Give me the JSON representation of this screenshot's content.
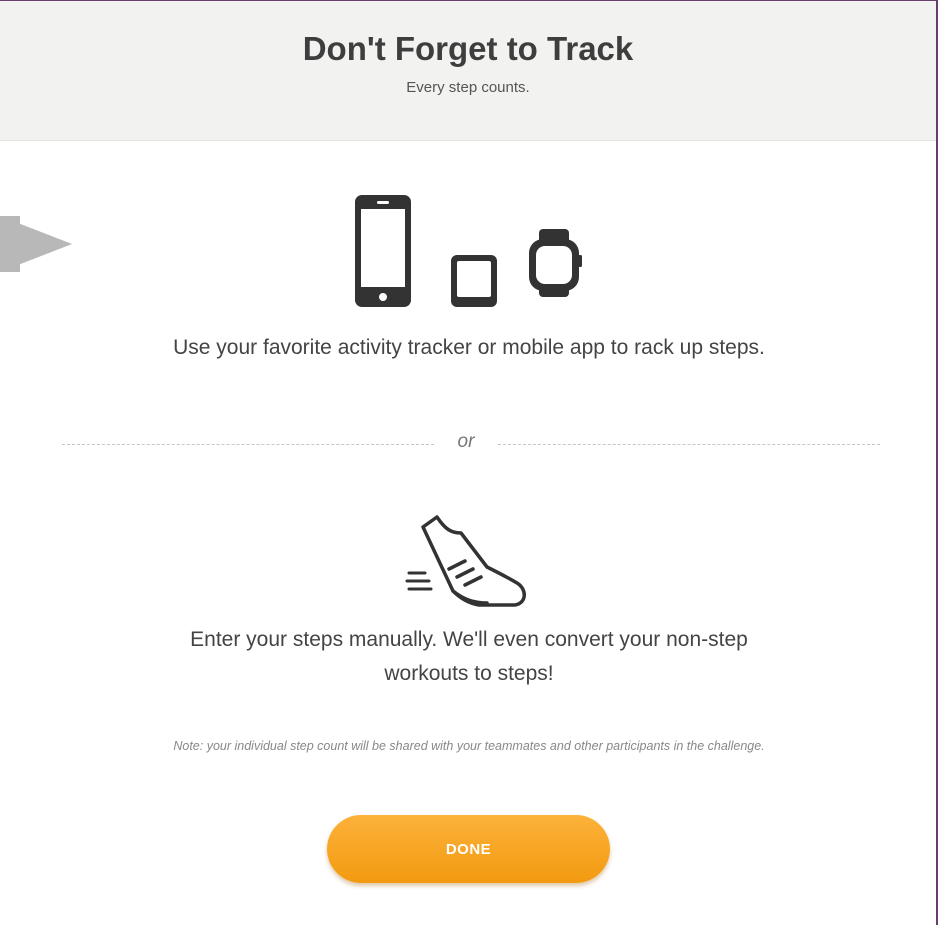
{
  "header": {
    "title": "Don't Forget to Track",
    "subtitle": "Every step counts."
  },
  "tracker_section": {
    "icons": [
      "phone-icon",
      "tablet-icon",
      "watch-icon"
    ],
    "text": "Use your favorite activity tracker or mobile app to rack up steps."
  },
  "divider": {
    "label": "or"
  },
  "manual_section": {
    "icon": "shoe-icon",
    "text": "Enter your steps manually. We'll even convert your non-step workouts to steps!"
  },
  "note": "Note: your individual step count will be shared with your teammates and other participants in the challenge.",
  "done_button": {
    "label": "DONE",
    "color": "#f6a623"
  },
  "colors": {
    "header_bg": "#f2f2f1",
    "icon": "#333333",
    "accent": "#f6a623",
    "frame_border": "#6a3d70",
    "pointer": "#b8b8b8"
  }
}
